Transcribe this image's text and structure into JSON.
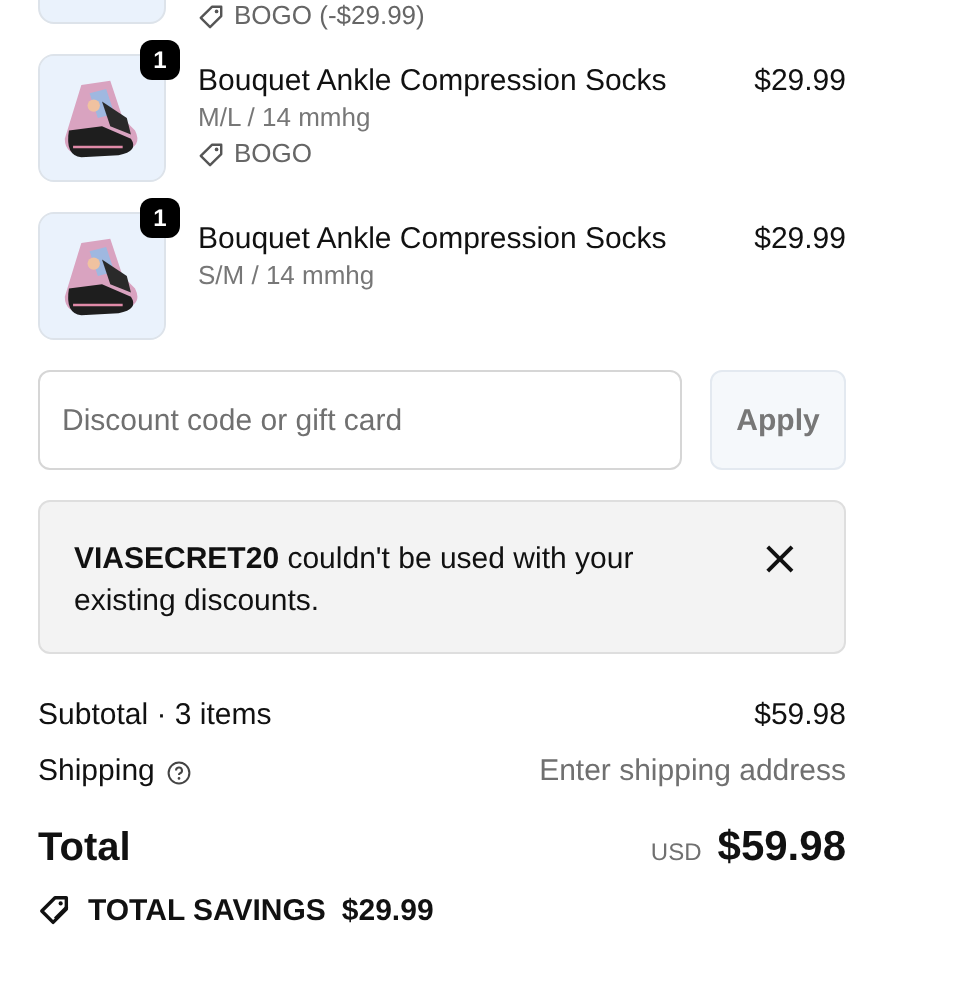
{
  "line_items": [
    {
      "discount": "BOGO (-$29.99)"
    },
    {
      "quantity": "1",
      "title": "Bouquet Ankle Compression Socks",
      "variant": "M/L / 14 mmhg",
      "discount": "BOGO",
      "price": "$29.99"
    },
    {
      "quantity": "1",
      "title": "Bouquet Ankle Compression Socks",
      "variant": "S/M / 14 mmhg",
      "price": "$29.99"
    }
  ],
  "discount_field": {
    "placeholder": "Discount code or gift card",
    "button": "Apply"
  },
  "alert": {
    "message": "**VIASECRET20** couldn't be used with your existing discounts.",
    "close": "×"
  },
  "summary": {
    "subtotal_label": "Subtotal · 3 items",
    "subtotal": "$59.98",
    "shipping_label": "Shipping",
    "shipping": "Enter shipping address",
    "total_label": "Total",
    "currency": "USD",
    "total": "$59.98",
    "savings_label": "TOTAL SAVINGS",
    "savings": "$29.99"
  }
}
